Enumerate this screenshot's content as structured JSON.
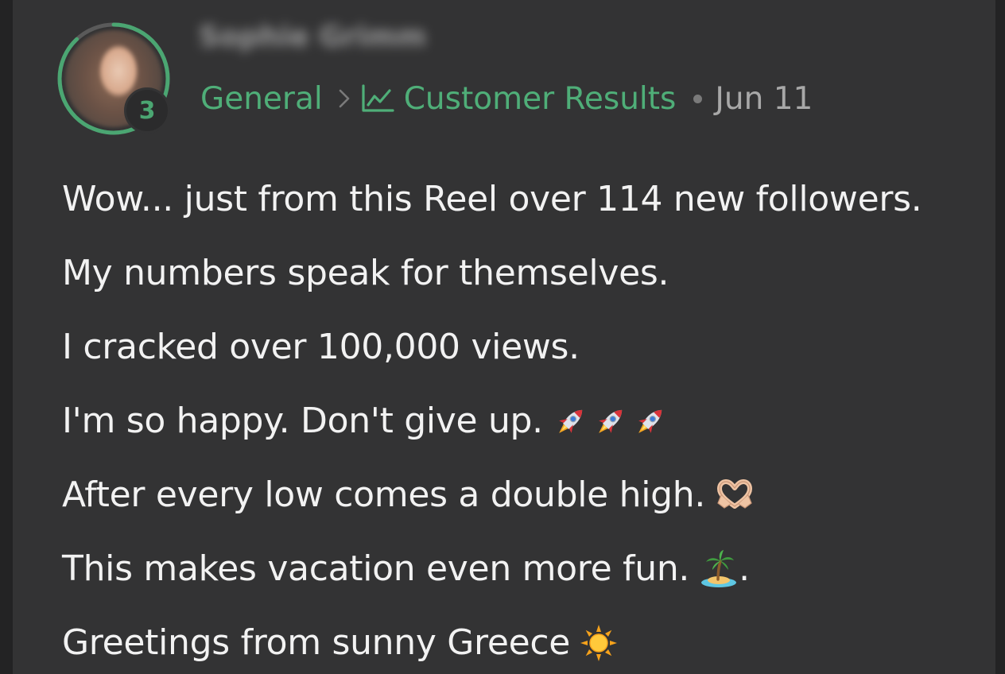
{
  "post": {
    "author_name": "Sophie Grimm",
    "author_level": "3",
    "breadcrumb": {
      "category": "General",
      "subcategory": "Customer Results"
    },
    "date": "Jun 11",
    "lines": [
      "Wow... just from this Reel over 114 new followers.",
      "My numbers speak for themselves.",
      "I cracked over 100,000 views.",
      "I'm so happy. Don't give up.",
      "After every low comes a double high.",
      "This makes vacation even more fun.",
      "Greetings from sunny Greece"
    ],
    "line_6_suffix": "."
  },
  "icons": {
    "chevron": "chevron-right-icon",
    "subcategory": "line-chart-icon",
    "line_4": [
      "rocket-icon",
      "rocket-icon",
      "rocket-icon"
    ],
    "line_5": "heart-hands-icon",
    "line_6": "desert-island-icon",
    "line_7": "sun-icon"
  },
  "colors": {
    "accent": "#4fae78",
    "background": "#232324",
    "card": "#333334",
    "text": "#f2f2f2",
    "muted": "#a8a8a8",
    "level_ring_progress": 0.88
  }
}
